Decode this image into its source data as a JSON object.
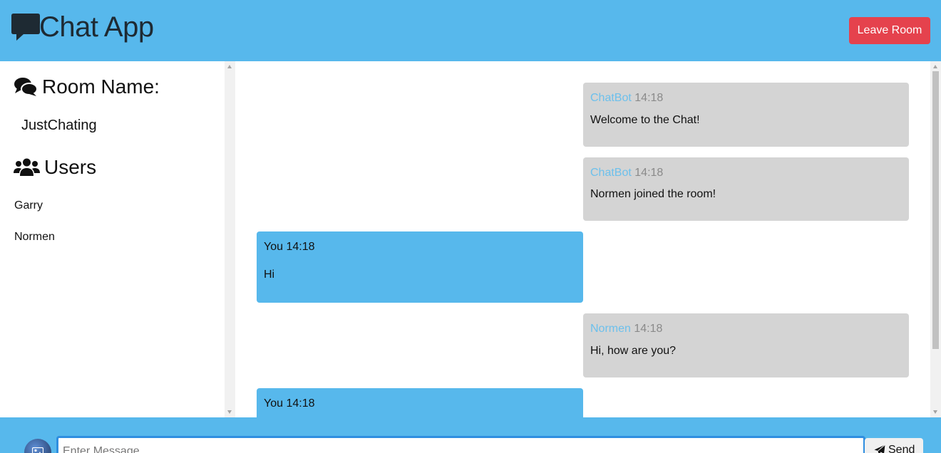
{
  "header": {
    "title": "Chat App",
    "leave_label": "Leave Room",
    "leave_color": "#e5424d",
    "bg_color": "#57b8ec"
  },
  "sidebar": {
    "room_heading": "Room Name:",
    "room_icon": "comments-icon",
    "room_name": "JustChating",
    "users_heading": "Users",
    "users_icon": "users-icon",
    "users": [
      "Garry",
      "Normen"
    ]
  },
  "messages": [
    {
      "author": "ChatBot",
      "time": "14:18",
      "text": "Welcome to the Chat!",
      "direction": "incoming"
    },
    {
      "author": "ChatBot",
      "time": "14:18",
      "text": "Normen joined the room!",
      "direction": "incoming"
    },
    {
      "author": "You",
      "time": "14:18",
      "text": "Hi",
      "direction": "outgoing"
    },
    {
      "author": "Normen",
      "time": "14:18",
      "text": "Hi, how are you?",
      "direction": "incoming"
    },
    {
      "author": "You",
      "time": "14:18",
      "text": "",
      "direction": "outgoing"
    }
  ],
  "composer": {
    "placeholder": "Enter Message",
    "value": "",
    "send_label": "Send",
    "send_icon": "paper-plane-icon",
    "image_icon": "image-icon"
  },
  "colors": {
    "incoming_bg": "#d4d4d4",
    "outgoing_bg": "#57b8ec",
    "author_accent": "#6cc0ec"
  }
}
